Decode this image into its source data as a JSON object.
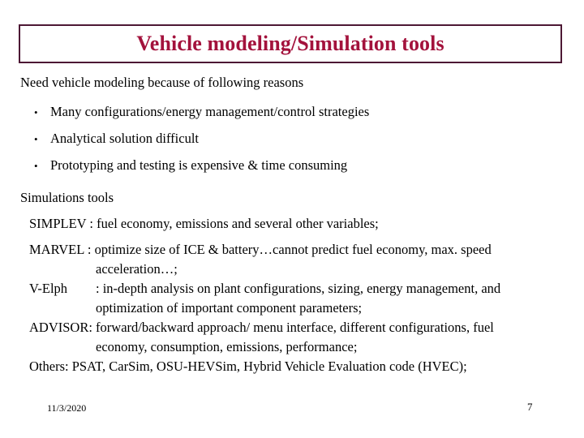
{
  "slide": {
    "title": "Vehicle modeling/Simulation tools",
    "title_color": "#a3123c",
    "title_border_color": "#4d1834",
    "background_color": "#ffffff",
    "body_text_color": "#000000"
  },
  "intro": {
    "lead": "Need vehicle modeling because of following reasons",
    "bullet_marker": "•",
    "bullets": [
      "Many configurations/energy management/control strategies",
      "Analytical solution difficult",
      "Prototyping and testing is expensive & time consuming"
    ]
  },
  "simulations": {
    "heading": "Simulations tools",
    "entries": {
      "simplev": {
        "line1": "SIMPLEV : fuel economy, emissions and several other variables;"
      },
      "marvel": {
        "line1": "MARVEL : optimize size of ICE & battery…cannot predict fuel economy, max. speed",
        "line2": "acceleration…;"
      },
      "velph": {
        "label": "V-Elph",
        "line1": ": in-depth analysis on plant configurations, sizing, energy management, and",
        "line2": "optimization of important component parameters;"
      },
      "advisor": {
        "line1": "ADVISOR: forward/backward approach/ menu interface, different configurations, fuel",
        "line2": "economy, consumption, emissions, performance;"
      },
      "others": {
        "line1": "Others: PSAT, CarSim, OSU-HEVSim, Hybrid Vehicle Evaluation code (HVEC);"
      }
    }
  },
  "footer": {
    "date": "11/3/2020",
    "page_number": "7"
  }
}
